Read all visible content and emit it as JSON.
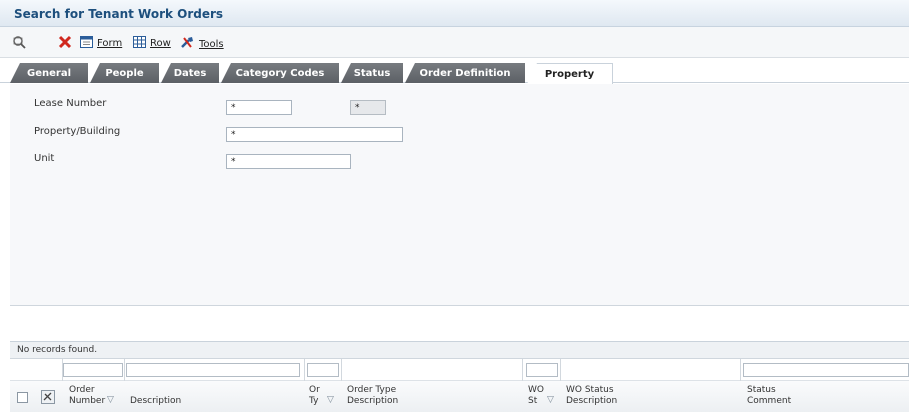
{
  "window": {
    "title": "Search for Tenant Work Orders"
  },
  "toolbar": {
    "form_label": "Form",
    "row_label": "Row",
    "tools_label": "Tools",
    "icons": [
      "find-icon",
      "delete-icon",
      "form-icon",
      "row-icon",
      "tools-icon"
    ]
  },
  "tabs": [
    {
      "label": "General"
    },
    {
      "label": "People"
    },
    {
      "label": "Dates"
    },
    {
      "label": "Category Codes"
    },
    {
      "label": "Status"
    },
    {
      "label": "Order Definition"
    },
    {
      "label": "Property"
    }
  ],
  "active_tab": "Property",
  "form": {
    "lease_number": {
      "label": "Lease Number",
      "value": "*",
      "extra_value": "*"
    },
    "property_building": {
      "label": "Property/Building",
      "value": "*"
    },
    "unit": {
      "label": "Unit",
      "value": "*"
    }
  },
  "grid": {
    "status": "No records found.",
    "columns": [
      {
        "line1": "Order",
        "line2": "Number"
      },
      {
        "line1": "",
        "line2": "Description"
      },
      {
        "line1": "Or",
        "line2": "Ty"
      },
      {
        "line1": "Order Type",
        "line2": "Description"
      },
      {
        "line1": "WO",
        "line2": "St"
      },
      {
        "line1": "WO Status",
        "line2": "Description"
      },
      {
        "line1": "Status",
        "line2": "Comment"
      }
    ]
  },
  "colors": {
    "title_text": "#1d4f7d",
    "tab_bg": "#5c6065",
    "delete_red": "#d0281e"
  }
}
